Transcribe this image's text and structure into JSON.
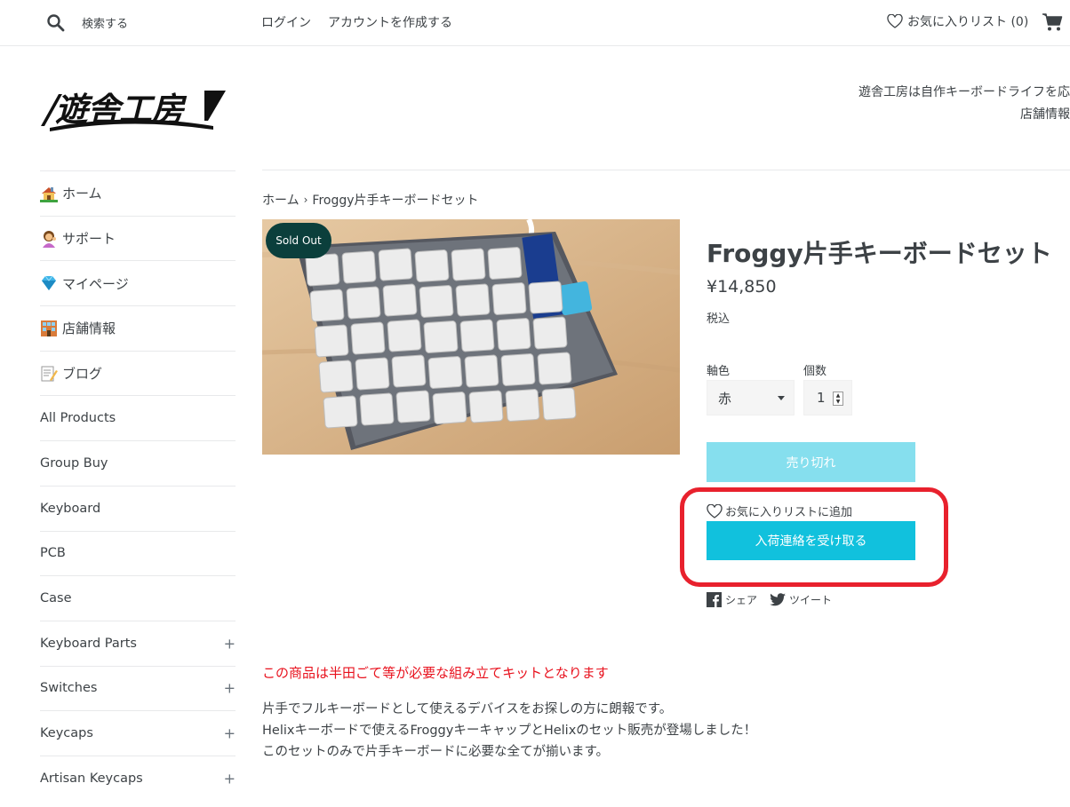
{
  "topbar": {
    "search_label": "検索する",
    "login": "ログイン",
    "register": "アカウントを作成する",
    "wishlist": "お気に入りリスト (0)"
  },
  "header": {
    "logo_text": "遊舎工房",
    "message_line1": "遊舎工房は自作キーボードライフを応",
    "message_line2": "店舗情報"
  },
  "sidebar": {
    "items": [
      {
        "label": "ホーム",
        "icon": "house-icon"
      },
      {
        "label": "サポート",
        "icon": "support-person-icon"
      },
      {
        "label": "マイページ",
        "icon": "gem-icon"
      },
      {
        "label": "店舗情報",
        "icon": "building-icon"
      },
      {
        "label": "ブログ",
        "icon": "memo-icon"
      },
      {
        "label": "All Products"
      },
      {
        "label": "Group Buy"
      },
      {
        "label": "Keyboard"
      },
      {
        "label": "PCB"
      },
      {
        "label": "Case"
      },
      {
        "label": "Keyboard Parts",
        "expand": "+"
      },
      {
        "label": "Switches",
        "expand": "+"
      },
      {
        "label": "Keycaps",
        "expand": "+"
      },
      {
        "label": "Artisan Keycaps",
        "expand": "+"
      }
    ]
  },
  "breadcrumb": {
    "home": "ホーム",
    "separator": "›",
    "current": "Froggy片手キーボードセット"
  },
  "product": {
    "badge": "Sold Out",
    "title": "Froggy片手キーボードセット",
    "price": "¥14,850",
    "tax_note": "税込",
    "option_label": "軸色",
    "option_value": "赤",
    "quantity_label": "個数",
    "quantity_value": "1",
    "soldout_button": "売り切れ",
    "add_favorite": "お気に入りリストに追加",
    "notify_button": "入荷連絡を受け取る",
    "share": "シェア",
    "tweet": "ツイート"
  },
  "description": {
    "warning": "この商品は半田ごて等が必要な組み立てキットとなります",
    "line1": "片手でフルキーボードとして使えるデバイスをお探しの方に朗報です。",
    "line2": "Helixキーボードで使えるFroggyキーキャップとHelixのセット販売が登場しました！",
    "line3": "このセットのみで片手キーボードに必要な全てが揃います。"
  },
  "colors": {
    "soldout_badge": "#0b3f3c",
    "soldout_button": "#86dfee",
    "notify_button": "#11c1dd",
    "highlight": "#e8212d",
    "warning_text": "#e8111d"
  }
}
